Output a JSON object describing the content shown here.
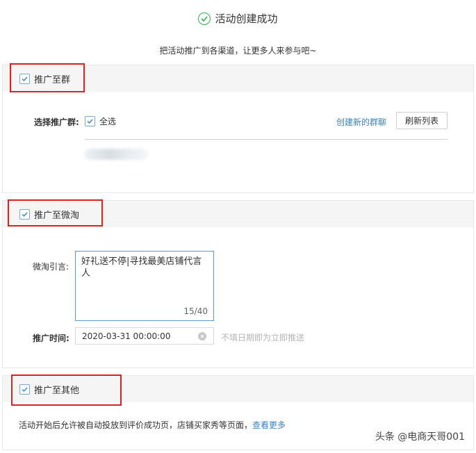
{
  "header": {
    "title": "活动创建成功",
    "subtitle": "把活动推广到各渠道，让更多人来参与吧~"
  },
  "group_section": {
    "checkbox_label": "推广至群",
    "checked": true,
    "select_label": "选择推广群:",
    "select_all_label": "全选",
    "create_group_link": "创建新的群聊",
    "refresh_button": "刷新列表"
  },
  "weitao_section": {
    "checkbox_label": "推广至微淘",
    "checked": true,
    "quote_label": "微淘引言:",
    "quote_value": "好礼送不停|寻找最美店铺代言人",
    "counter": "15/40",
    "time_label": "推广时间:",
    "time_value": "2020-03-31 00:00:00",
    "time_hint": "不填日期即为立即推送"
  },
  "other_section": {
    "checkbox_label": "推广至其他",
    "checked": true,
    "description": "活动开始后允许被自动投放到评价成功页，店铺买家秀等页面，",
    "more_link": "查看更多"
  },
  "watermark": "头条 @电商天哥001",
  "colors": {
    "success": "#2fb54a",
    "link": "#3b82c4",
    "highlight_box": "#e02020",
    "checkbox_border": "#7aa7d8"
  }
}
